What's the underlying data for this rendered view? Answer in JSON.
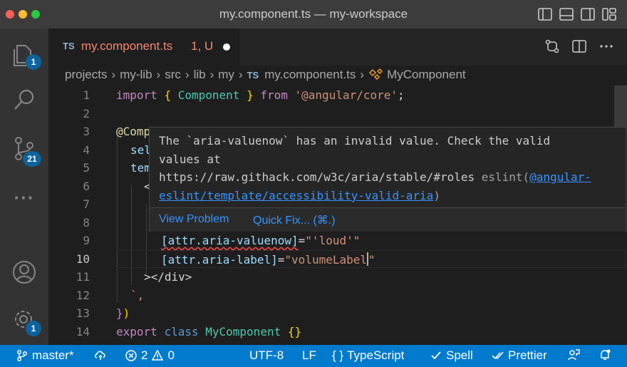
{
  "window": {
    "title": "my.component.ts — my-workspace"
  },
  "activity_bar": {
    "explorer_badge": "1",
    "scm_badge": "21",
    "settings_badge": "1",
    "more_label": "···"
  },
  "tab": {
    "file_type": "TS",
    "name": "my.component.ts",
    "status": "1, U"
  },
  "breadcrumb": {
    "items": [
      "projects",
      "my-lib",
      "src",
      "lib",
      "my"
    ],
    "file_type": "TS",
    "file": "my.component.ts",
    "symbol": "MyComponent"
  },
  "editor": {
    "line_numbers": [
      "1",
      "2",
      "3",
      "4",
      "5",
      "6",
      "7",
      "8",
      "9",
      "10",
      "11",
      "12",
      "13",
      "14"
    ],
    "active_line": "10",
    "lines": {
      "l1": {
        "import": "import",
        "open": "{",
        "name": "Component",
        "close": "}",
        "from": "from",
        "module": "'@angular/core'",
        "semi": ";"
      },
      "l3": {
        "at": "@",
        "name": "Compo",
        "paren": "(",
        "brace": "{"
      },
      "l4": {
        "text": "sel"
      },
      "l5": {
        "text": "tem"
      },
      "l6": {
        "text": "<"
      },
      "l9": {
        "attr": "[attr.aria-valuenow]",
        "eq": "=",
        "value": "\"'loud'\""
      },
      "l10": {
        "attr": "[attr.aria-label]",
        "eq": "=",
        "value_open": "\"volumeLabel",
        "value_close": "\""
      },
      "l11": {
        "text": "></div>"
      },
      "l12": {
        "text": "`,"
      },
      "l13": {
        "brace": "}",
        "paren": ")"
      },
      "l14": {
        "export": "export",
        "class": "class",
        "name": "MyComponent",
        "body": "{}"
      }
    }
  },
  "hover": {
    "message_line1": "The `aria-valuenow` has an invalid value. Check the valid",
    "message_line2": "values at",
    "message_line3": "https://raw.githack.com/w3c/aria/stable/#roles",
    "source": "eslint(",
    "rule_link_part1": "@angular-",
    "rule_link_part2": "eslint/template/accessibility-valid-aria",
    "source_close": ")",
    "view_problem": "View Problem",
    "quick_fix": "Quick Fix... (⌘.)"
  },
  "statusbar": {
    "branch": "master*",
    "errors": "2",
    "warnings": "0",
    "encoding": "UTF-8",
    "eol": "LF",
    "language_brackets": "{ }",
    "language": "TypeScript",
    "spell": "Spell",
    "prettier": "Prettier"
  },
  "colors": {
    "accent": "#007acc",
    "error": "#f48771",
    "link": "#3794ff"
  }
}
